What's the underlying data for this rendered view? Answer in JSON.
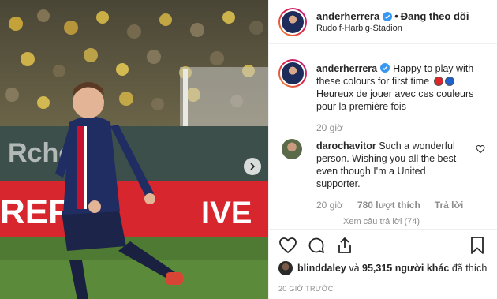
{
  "header": {
    "username": "anderherrera",
    "separator": "•",
    "follow_state": "Đang theo dõi",
    "location": "Rudolf-Harbig-Stadion"
  },
  "caption": {
    "username": "anderherrera",
    "text_line1": "Happy to play with these colours for first time",
    "text_line2": "Heureux de jouer avec ces couleurs pour la première fois",
    "emoji": [
      {
        "name": "red-circle-emoji",
        "color": "#e0242b"
      },
      {
        "name": "blue-circle-emoji",
        "color": "#1e62d0"
      }
    ],
    "time": "20 giờ"
  },
  "comment": {
    "username": "darochavitor",
    "text": "Such a wonderful person. Wishing you all the best even though I'm a United supporter.",
    "time": "20 giờ",
    "likes": "780 lượt thích",
    "reply_label": "Trả lời",
    "view_replies": "Xem câu trả lời (74)"
  },
  "likes": {
    "first_user": "blinddaley",
    "connector": "và",
    "others": "95,315 người khác",
    "suffix": "đã thích"
  },
  "post_time": "20 GIỜ TRƯỚC",
  "icons": {
    "verified": "verified-badge-icon",
    "like": "heart-icon",
    "comment": "comment-bubble-icon",
    "share": "share-icon",
    "save": "bookmark-icon",
    "next": "chevron-right-icon"
  },
  "colors": {
    "verified": "#3897f0",
    "text": "#262626",
    "muted": "#8e8e8e",
    "border": "#efefef"
  }
}
